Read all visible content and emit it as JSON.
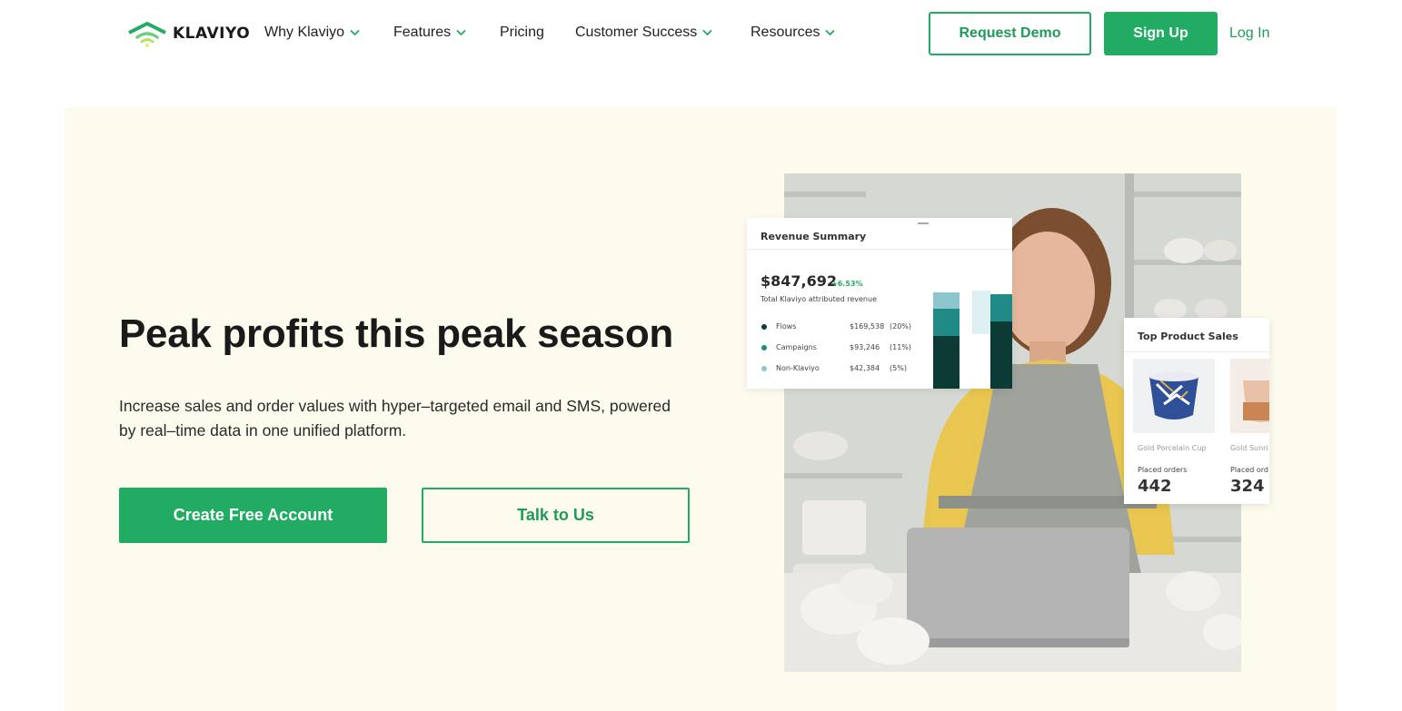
{
  "brand": {
    "name": "KLAVIYO",
    "accent": "#22ac63",
    "hero_bg": "#fdfbed"
  },
  "nav": {
    "items": [
      {
        "label": "Why Klaviyo",
        "dropdown": true
      },
      {
        "label": "Features",
        "dropdown": true
      },
      {
        "label": "Pricing",
        "dropdown": false
      },
      {
        "label": "Customer Success",
        "dropdown": true
      },
      {
        "label": "Resources",
        "dropdown": true
      }
    ],
    "request_demo": "Request Demo",
    "sign_up": "Sign Up",
    "log_in": "Log In"
  },
  "hero": {
    "headline": "Peak profits this peak season",
    "subcopy": "Increase sales and order values with hyper–targeted email and SMS, powered by real–time data in one unified platform.",
    "primary_cta": "Create Free Account",
    "secondary_cta": "Talk to Us"
  },
  "revenue_card": {
    "title": "Revenue Summary",
    "total": "$847,692",
    "change": "+6.53%",
    "subtitle": "Total Klaviyo attributed revenue",
    "rows": [
      {
        "label": "Flows",
        "amount": "$169,538",
        "pct": "(20%)",
        "color": "#0c3b36"
      },
      {
        "label": "Campaigns",
        "amount": "$93,246",
        "pct": "(11%)",
        "color": "#1f8a86"
      },
      {
        "label": "Non-Klaviyo",
        "amount": "$42,384",
        "pct": "(5%)",
        "color": "#8cc7cf"
      }
    ]
  },
  "product_card": {
    "title": "Top Product Sales",
    "products": [
      {
        "name": "Gold Porcelain Cup",
        "label": "Placed orders",
        "orders": "442"
      },
      {
        "name": "Gold Sunri",
        "label": "Placed ord",
        "orders": "324"
      }
    ]
  }
}
